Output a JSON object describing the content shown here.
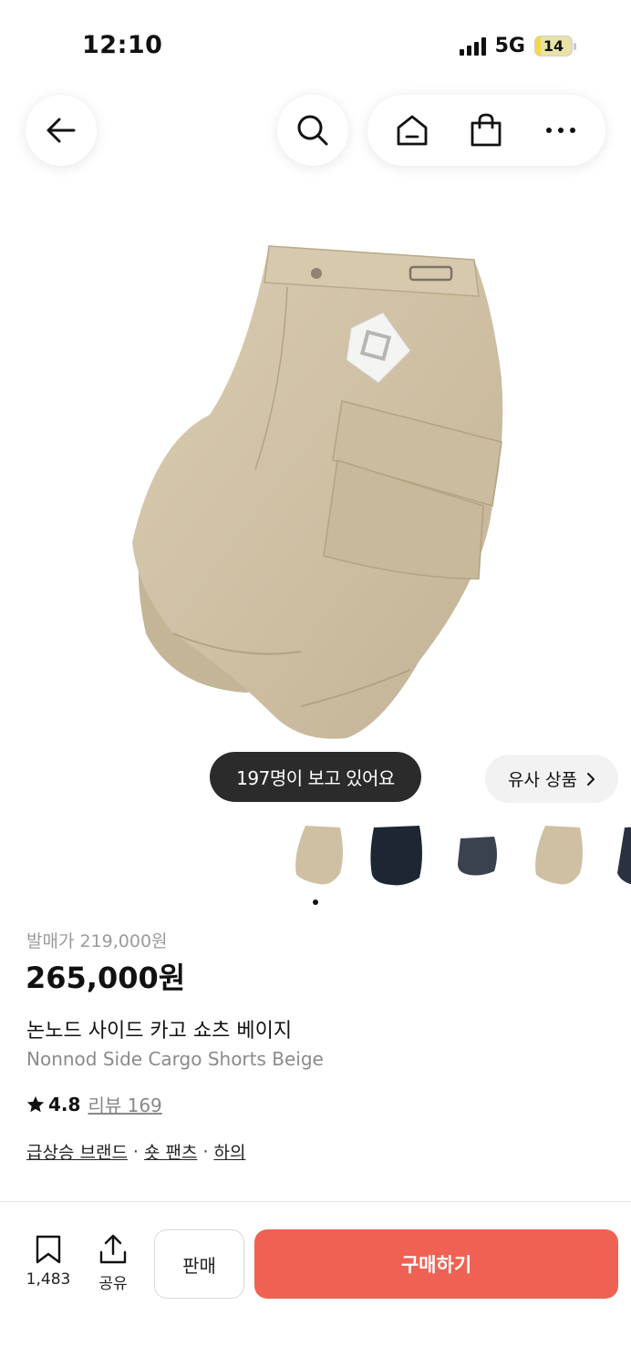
{
  "status_bar": {
    "time": "12:10",
    "network": "5G",
    "battery_level": "14",
    "battery_fraction": 0.14
  },
  "nav": {
    "back_icon": "arrow-left-icon",
    "search_icon": "search-icon",
    "home_icon": "home-icon",
    "cart_icon": "shopping-bag-icon",
    "more_icon": "more-horizontal-icon"
  },
  "gallery": {
    "viewers_badge": "197명이 보고 있어요",
    "similar_button": "유사 상품",
    "thumbnail_colors": [
      "beige",
      "navy",
      "navy",
      "beige",
      "navy"
    ],
    "active_index": 0
  },
  "product": {
    "original_price": "발매가 219,000원",
    "price": "265,000원",
    "name_ko": "논노드 사이드 카고 쇼츠 베이지",
    "name_en": "Nonnod Side Cargo Shorts Beige",
    "rating": "4.8",
    "review_link": "리뷰 169",
    "categories": [
      "급상승 브랜드",
      "숏 팬츠",
      "하의"
    ]
  },
  "bottom_bar": {
    "save_count": "1,483",
    "share_label": "공유",
    "sell_label": "판매",
    "buy_label": "구매하기",
    "buy_color": "#ef6253"
  }
}
